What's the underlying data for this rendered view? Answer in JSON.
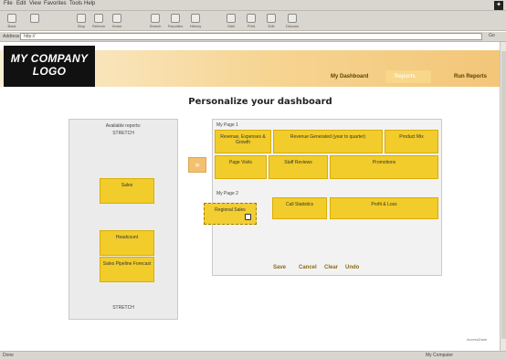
{
  "browser": {
    "menu": [
      "File",
      "Edit",
      "View",
      "Favorites",
      "Tools",
      "Help"
    ],
    "toolbar": [
      {
        "label": "Back",
        "icon": "back-icon"
      },
      {
        "label": "",
        "icon": "forward-icon"
      },
      {
        "label": "Stop",
        "icon": "stop-icon"
      },
      {
        "label": "Refresh",
        "icon": "refresh-icon"
      },
      {
        "label": "Home",
        "icon": "home-icon"
      },
      {
        "label": "Search",
        "icon": "search-icon"
      },
      {
        "label": "Favorites",
        "icon": "favorites-icon"
      },
      {
        "label": "History",
        "icon": "history-icon"
      },
      {
        "label": "Mail",
        "icon": "mail-icon"
      },
      {
        "label": "Print",
        "icon": "print-icon"
      },
      {
        "label": "Edit",
        "icon": "edit-icon"
      },
      {
        "label": "Discuss",
        "icon": "discuss-icon"
      }
    ],
    "address_label": "Address",
    "address_value": "http://",
    "go_label": "Go",
    "status_text": "Done",
    "status_zone": "My Computer"
  },
  "header": {
    "logo_line1": "MY COMPANY",
    "logo_line2": "LOGO",
    "nav": [
      "My Dashboard",
      "Reports",
      "Run Reports"
    ]
  },
  "page_title": "Personalize your dashboard",
  "available": {
    "heading": "Available reports:",
    "subheading": "STRETCH",
    "reports": [
      "Sales",
      "Headcount",
      "Sales Pipeline Forecast"
    ],
    "footer": "STRETCH"
  },
  "arrow_label": "»",
  "layout": {
    "page1_label": "My Page 1",
    "page1_row1": [
      "Revenue, Expenses & Growth",
      "Revenue Generated (year to quarter)",
      "Product Mix"
    ],
    "page1_row2": [
      "Page Visits",
      "Staff Reviews",
      "Promotions"
    ],
    "page2_label": "My Page 2",
    "page2_slots": [
      "Call Statistics",
      "Profit & Loss"
    ],
    "dragging": "Regional Sales"
  },
  "actions": [
    "Save",
    "Cancel",
    "Clear",
    "Undo"
  ],
  "watermark": "AccessDash"
}
